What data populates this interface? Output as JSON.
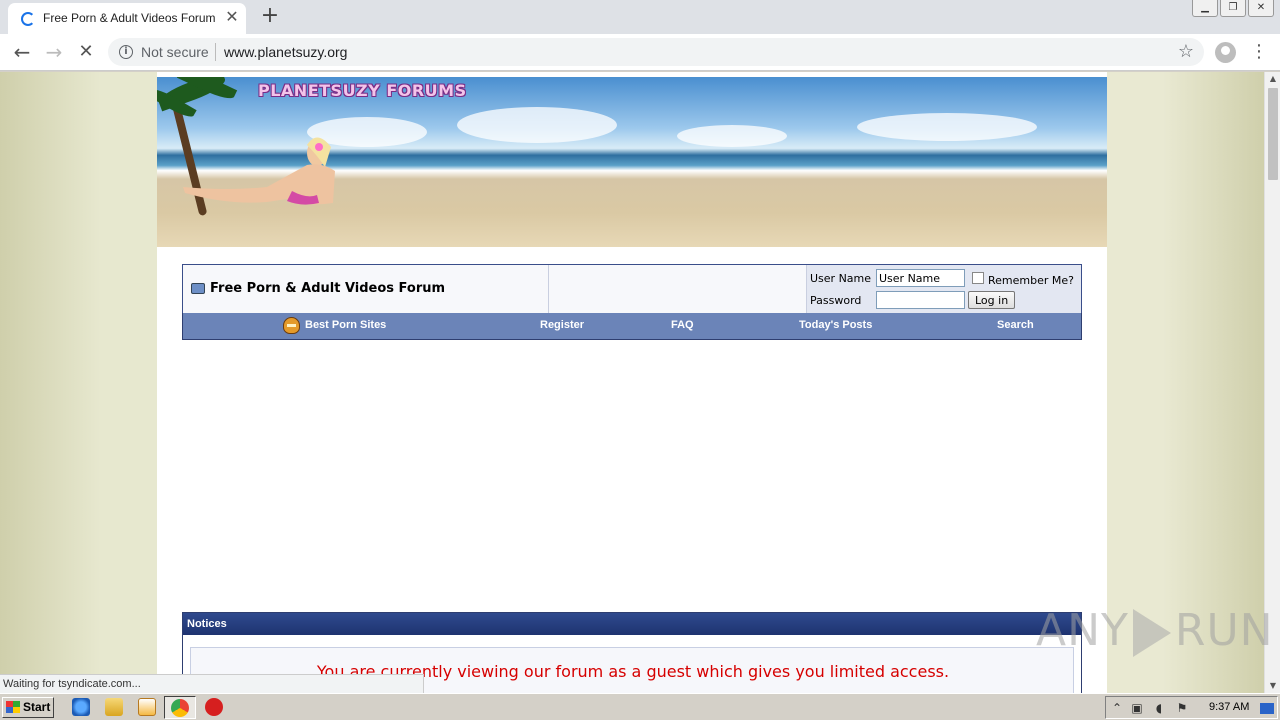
{
  "browser": {
    "tab_title": "Free Porn & Adult Videos Forum",
    "tab_close": "✕",
    "new_tab": "+",
    "security_label": "Not secure",
    "url": "www.planetsuzy.org",
    "status_text": "Waiting for tsyndicate.com..."
  },
  "window_controls": [
    "▁",
    "❐",
    "✕"
  ],
  "banner": {
    "logo_text": "PLANETSUZY FORUMS"
  },
  "header": {
    "forum_title": "Free Porn & Adult Videos Forum",
    "username_label": "User Name",
    "username_value": "User Name",
    "remember_label": "Remember Me?",
    "password_label": "Password",
    "password_value": "",
    "login_button": "Log in"
  },
  "navbar": {
    "items": [
      "Best Porn Sites",
      "Register",
      "FAQ",
      "Today's Posts",
      "Search"
    ]
  },
  "notices": {
    "heading": "Notices",
    "message": "You are currently viewing our forum as a guest which gives you limited access."
  },
  "watermark": {
    "left": "ANY",
    "right": "RUN"
  },
  "taskbar": {
    "start_label": "Start",
    "clock": "9:37 AM"
  }
}
